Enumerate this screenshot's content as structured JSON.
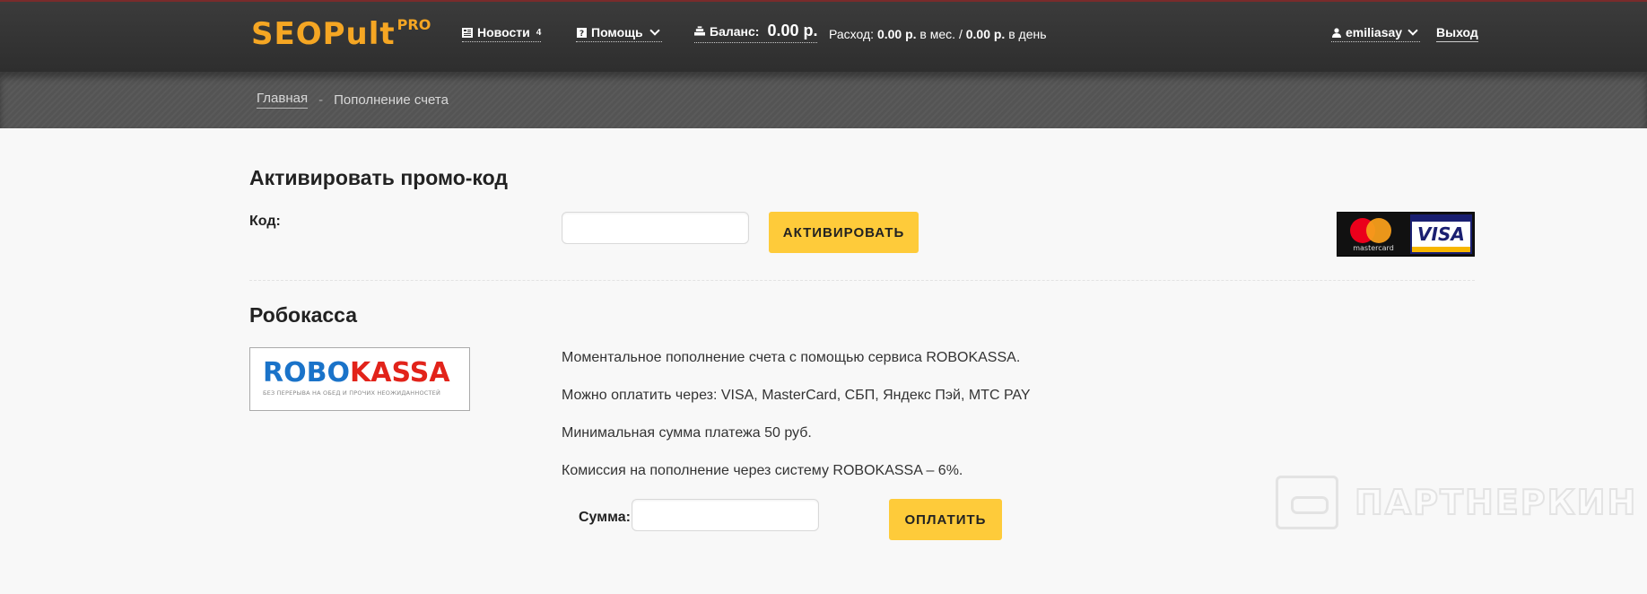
{
  "header": {
    "logo_text": "SEOPult",
    "logo_pro": "PRO",
    "news_label": "Новости",
    "news_count": "4",
    "help_label": "Помощь",
    "balance_label": "Баланс:",
    "balance_value": "0.00 р.",
    "spend_label": "Расход:",
    "spend_month_value": "0.00 р.",
    "spend_month_suffix": "в мес. /",
    "spend_day_value": "0.00 р.",
    "spend_day_suffix": "в день",
    "username": "emiliasay",
    "logout_label": "Выход"
  },
  "breadcrumb": {
    "home": "Главная",
    "separator": "-",
    "current": "Пополнение счета"
  },
  "promo": {
    "title": "Активировать промо-код",
    "code_label": "Код:",
    "code_value": "",
    "activate_label": "АКТИВИРОВАТЬ",
    "mastercard_text": "mastercard",
    "visa_text": "VISA"
  },
  "robokassa": {
    "title": "Робокасса",
    "logo_part1": "ROBO",
    "logo_part2": "KASSA",
    "logo_tagline": "БЕЗ ПЕРЕРЫВА НА ОБЕД И ПРОЧИХ НЕОЖИДАННОСТЕЙ",
    "line1": "Моментальное пополнение счета с помощью сервиса ROBOKASSA.",
    "line2": "Можно оплатить через: VISA, MasterCard, СБП, Яндекс Пэй, МТС PAY",
    "line3": "Минимальная сумма платежа 50 руб.",
    "line4": "Комиссия на пополнение через систему ROBOKASSA – 6%.",
    "amount_label": "Сумма:",
    "amount_value": "",
    "pay_label": "ОПЛАТИТЬ"
  },
  "watermark": {
    "text": "ПАРТНЕРКИН"
  }
}
